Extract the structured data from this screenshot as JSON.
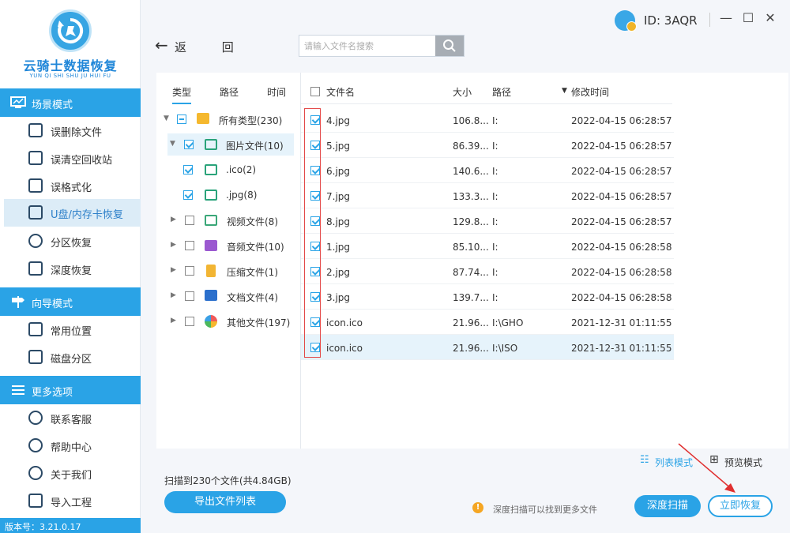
{
  "app": {
    "logo_title": "云骑士数据恢复",
    "logo_subtitle": "YUN QI SHI SHU JU HUI FU",
    "version": "版本号：3.21.0.17",
    "user_id": "ID: 3AQR",
    "accent_color": "#2aa3e6"
  },
  "sidebar": {
    "sections": [
      {
        "title": "场景模式",
        "icon": "monitor-icon",
        "items": [
          {
            "label": "误删除文件",
            "icon": "file-delete-icon"
          },
          {
            "label": "误清空回收站",
            "icon": "recycle-bin-icon"
          },
          {
            "label": "误格式化",
            "icon": "format-disk-icon"
          },
          {
            "label": "U盘/内存卡恢复",
            "icon": "usb-drive-icon",
            "active": true
          },
          {
            "label": "分区恢复",
            "icon": "partition-icon"
          },
          {
            "label": "深度恢复",
            "icon": "deep-recovery-icon"
          }
        ]
      },
      {
        "title": "向导模式",
        "icon": "signpost-icon",
        "items": [
          {
            "label": "常用位置",
            "icon": "windows-icon"
          },
          {
            "label": "磁盘分区",
            "icon": "disk-partition-icon"
          }
        ]
      },
      {
        "title": "更多选项",
        "icon": "menu-icon",
        "items": [
          {
            "label": "联系客服",
            "icon": "phone-icon"
          },
          {
            "label": "帮助中心",
            "icon": "help-icon"
          },
          {
            "label": "关于我们",
            "icon": "info-icon"
          },
          {
            "label": "导入工程",
            "icon": "import-icon"
          }
        ]
      }
    ]
  },
  "toolbar": {
    "back_label": "返 回",
    "search_placeholder": "请输入文件名搜索"
  },
  "tree": {
    "tabs": [
      "类型",
      "路径",
      "时间"
    ],
    "nodes": [
      {
        "label": "所有类型(230)",
        "icon": "folder-icon",
        "state": "partial",
        "expanded": true
      },
      {
        "label": "图片文件(10)",
        "icon": "image-icon",
        "state": "checked",
        "expanded": true,
        "selected": true
      },
      {
        "label": ".ico(2)",
        "icon": "image-icon",
        "state": "checked"
      },
      {
        "label": ".jpg(8)",
        "icon": "image-icon",
        "state": "checked"
      },
      {
        "label": "视频文件(8)",
        "icon": "video-icon",
        "state": "unchecked"
      },
      {
        "label": "音频文件(10)",
        "icon": "music-icon",
        "state": "unchecked"
      },
      {
        "label": "压缩文件(1)",
        "icon": "archive-icon",
        "state": "unchecked"
      },
      {
        "label": "文档文件(4)",
        "icon": "document-icon",
        "state": "unchecked"
      },
      {
        "label": "其他文件(197)",
        "icon": "other-files-icon",
        "state": "unchecked"
      }
    ]
  },
  "file_list": {
    "columns": {
      "name": "文件名",
      "size": "大小",
      "path": "路径",
      "mtime": "修改时间"
    },
    "rows": [
      {
        "name": "4.jpg",
        "size": "106.8...",
        "path": "I:",
        "mtime": "2022-04-15 06:28:57"
      },
      {
        "name": "5.jpg",
        "size": "86.39...",
        "path": "I:",
        "mtime": "2022-04-15 06:28:57"
      },
      {
        "name": "6.jpg",
        "size": "140.6...",
        "path": "I:",
        "mtime": "2022-04-15 06:28:57"
      },
      {
        "name": "7.jpg",
        "size": "133.3...",
        "path": "I:",
        "mtime": "2022-04-15 06:28:57"
      },
      {
        "name": "8.jpg",
        "size": "129.8...",
        "path": "I:",
        "mtime": "2022-04-15 06:28:57"
      },
      {
        "name": "1.jpg",
        "size": "85.10...",
        "path": "I:",
        "mtime": "2022-04-15 06:28:58"
      },
      {
        "name": "2.jpg",
        "size": "87.74...",
        "path": "I:",
        "mtime": "2022-04-15 06:28:58"
      },
      {
        "name": "3.jpg",
        "size": "139.7...",
        "path": "I:",
        "mtime": "2022-04-15 06:28:58"
      },
      {
        "name": "icon.ico",
        "size": "21.96...",
        "path": "I:\\GHO",
        "mtime": "2021-12-31 01:11:55"
      },
      {
        "name": "icon.ico",
        "size": "21.96...",
        "path": "I:\\ISO",
        "mtime": "2021-12-31 01:11:55"
      }
    ]
  },
  "view_modes": {
    "list": "列表模式",
    "preview": "预览模式"
  },
  "footer": {
    "scan_summary": "扫描到230个文件(共4.84GB)",
    "export_button": "导出文件列表",
    "tip": "深度扫描可以找到更多文件",
    "deep_scan_button": "深度扫描",
    "recover_button": "立即恢复"
  }
}
